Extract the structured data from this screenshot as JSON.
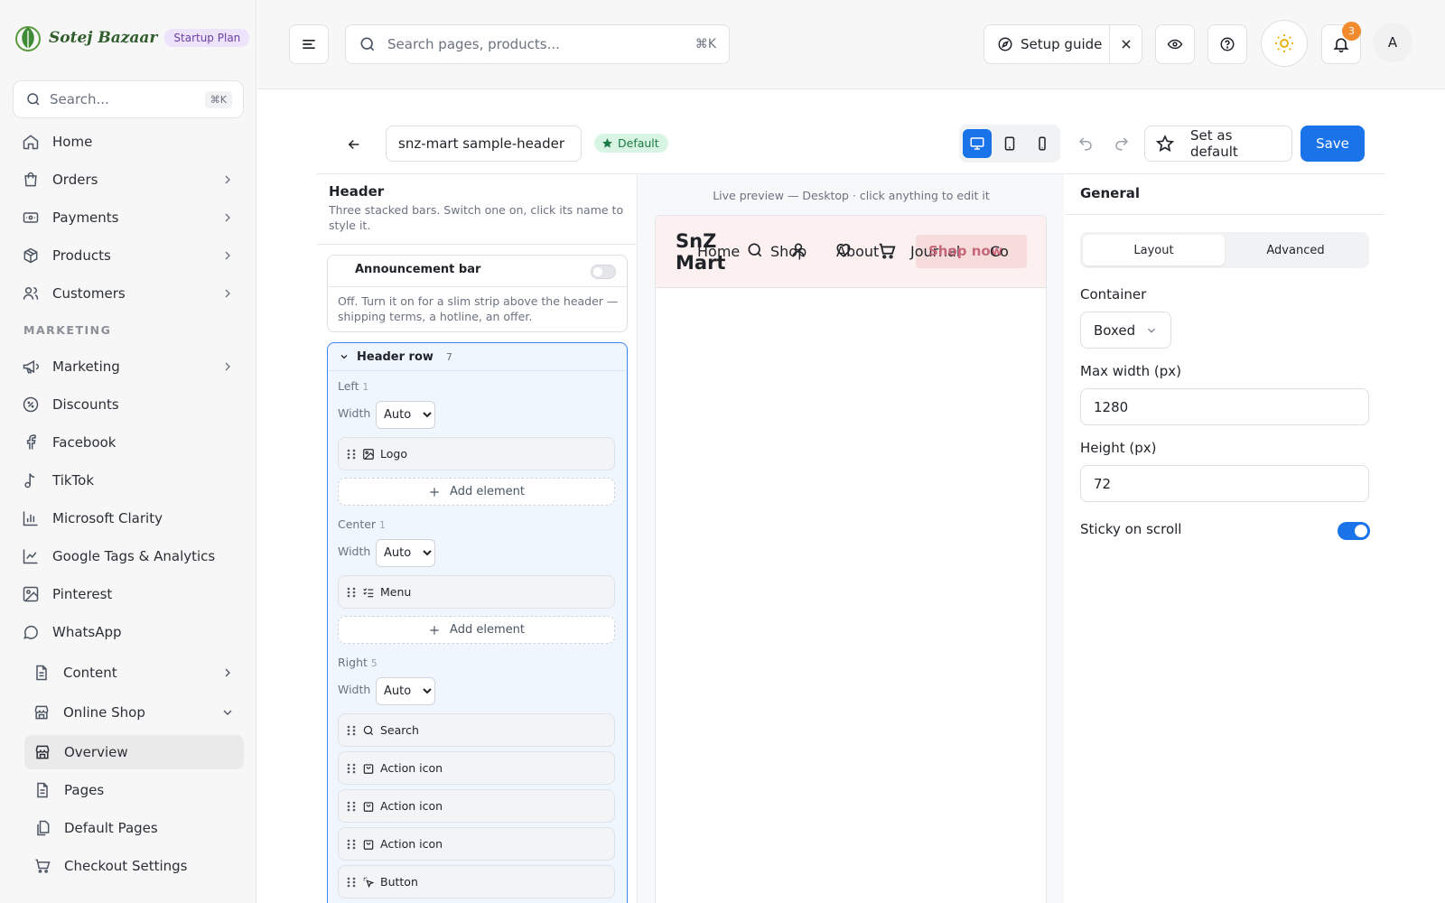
{
  "brand": {
    "name": "Sotej Bazaar",
    "plan": "Startup Plan"
  },
  "sidebar": {
    "search_placeholder": "Search...",
    "search_kbd": "⌘K",
    "items": [
      {
        "label": "Home"
      },
      {
        "label": "Orders"
      },
      {
        "label": "Payments"
      },
      {
        "label": "Products"
      },
      {
        "label": "Customers"
      }
    ],
    "marketing_heading": "MARKETING",
    "marketing_items": [
      {
        "label": "Marketing"
      },
      {
        "label": "Discounts"
      },
      {
        "label": "Facebook"
      },
      {
        "label": "TikTok"
      },
      {
        "label": "Microsoft Clarity"
      },
      {
        "label": "Google Tags & Analytics"
      },
      {
        "label": "Pinterest"
      },
      {
        "label": "WhatsApp"
      },
      {
        "label": "Content"
      },
      {
        "label": "Online Shop"
      }
    ],
    "shop_sub": [
      {
        "label": "Overview"
      },
      {
        "label": "Pages"
      },
      {
        "label": "Default Pages"
      },
      {
        "label": "Checkout Settings"
      }
    ]
  },
  "topbar": {
    "search_placeholder": "Search pages, products...",
    "search_kbd": "⌘K",
    "setup_label": "Setup guide",
    "notif_count": "3",
    "avatar_initial": "A"
  },
  "editor": {
    "header_name": "snz-mart sample-header",
    "default_badge": "Default",
    "set_default_label": "Set as default",
    "save_label": "Save",
    "active_device": "desktop"
  },
  "left_panel": {
    "title": "Header",
    "description": "Three stacked bars. Switch one on, click its name to style it.",
    "announcement": {
      "title": "Announcement bar",
      "enabled": false,
      "description": "Off. Turn it on for a slim strip above the header — shipping terms, a hotline, an offer."
    },
    "header_row": {
      "title": "Header row",
      "count": "7",
      "width_label": "Width",
      "add_label": "Add element",
      "left": {
        "label": "Left",
        "count": "1",
        "width": "Auto",
        "elements": [
          {
            "label": "Logo"
          }
        ]
      },
      "center": {
        "label": "Center",
        "count": "1",
        "width": "Auto",
        "elements": [
          {
            "label": "Menu"
          }
        ]
      },
      "right": {
        "label": "Right",
        "count": "5",
        "width": "Auto",
        "elements": [
          {
            "label": "Search"
          },
          {
            "label": "Action icon"
          },
          {
            "label": "Action icon"
          },
          {
            "label": "Action icon"
          },
          {
            "label": "Button"
          }
        ]
      }
    }
  },
  "preview": {
    "caption": "Live preview — Desktop · click anything to edit it",
    "logo": "SnZ Mart",
    "menu": [
      "Home",
      "Shop",
      "About",
      "Journal",
      "Co"
    ],
    "button": "Shop now"
  },
  "right_panel": {
    "title": "General",
    "tabs": [
      "Layout",
      "Advanced"
    ],
    "active_tab": "Layout",
    "container_label": "Container",
    "container_value": "Boxed",
    "max_width_label": "Max width (px)",
    "max_width_value": "1280",
    "height_label": "Height (px)",
    "height_value": "72",
    "sticky_label": "Sticky on scroll",
    "sticky_on": true
  },
  "colors": {
    "primary": "#1a73e8",
    "badge": "#f28a2e",
    "brand_green": "#2f5d2c",
    "plan_bg": "#ede4fb",
    "default_green": "#1a7a45"
  }
}
